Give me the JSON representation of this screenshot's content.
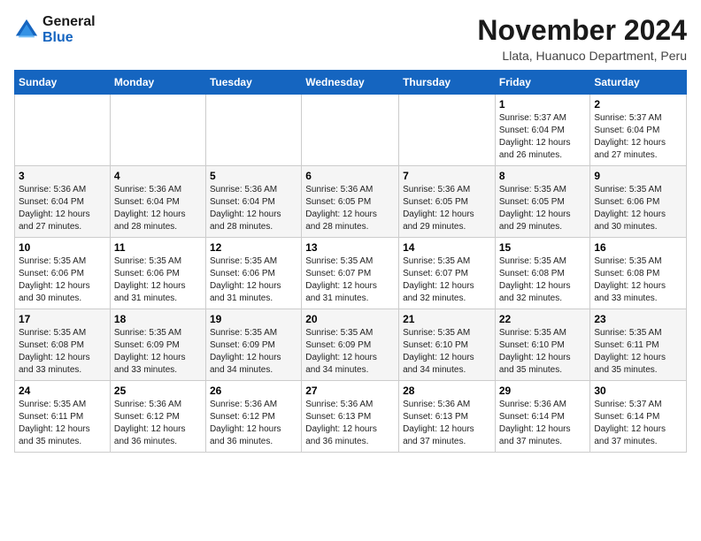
{
  "logo": {
    "line1": "General",
    "line2": "Blue"
  },
  "title": "November 2024",
  "location": "Llata, Huanuco Department, Peru",
  "days_of_week": [
    "Sunday",
    "Monday",
    "Tuesday",
    "Wednesday",
    "Thursday",
    "Friday",
    "Saturday"
  ],
  "weeks": [
    [
      {
        "day": "",
        "info": ""
      },
      {
        "day": "",
        "info": ""
      },
      {
        "day": "",
        "info": ""
      },
      {
        "day": "",
        "info": ""
      },
      {
        "day": "",
        "info": ""
      },
      {
        "day": "1",
        "info": "Sunrise: 5:37 AM\nSunset: 6:04 PM\nDaylight: 12 hours\nand 26 minutes."
      },
      {
        "day": "2",
        "info": "Sunrise: 5:37 AM\nSunset: 6:04 PM\nDaylight: 12 hours\nand 27 minutes."
      }
    ],
    [
      {
        "day": "3",
        "info": "Sunrise: 5:36 AM\nSunset: 6:04 PM\nDaylight: 12 hours\nand 27 minutes."
      },
      {
        "day": "4",
        "info": "Sunrise: 5:36 AM\nSunset: 6:04 PM\nDaylight: 12 hours\nand 28 minutes."
      },
      {
        "day": "5",
        "info": "Sunrise: 5:36 AM\nSunset: 6:04 PM\nDaylight: 12 hours\nand 28 minutes."
      },
      {
        "day": "6",
        "info": "Sunrise: 5:36 AM\nSunset: 6:05 PM\nDaylight: 12 hours\nand 28 minutes."
      },
      {
        "day": "7",
        "info": "Sunrise: 5:36 AM\nSunset: 6:05 PM\nDaylight: 12 hours\nand 29 minutes."
      },
      {
        "day": "8",
        "info": "Sunrise: 5:35 AM\nSunset: 6:05 PM\nDaylight: 12 hours\nand 29 minutes."
      },
      {
        "day": "9",
        "info": "Sunrise: 5:35 AM\nSunset: 6:06 PM\nDaylight: 12 hours\nand 30 minutes."
      }
    ],
    [
      {
        "day": "10",
        "info": "Sunrise: 5:35 AM\nSunset: 6:06 PM\nDaylight: 12 hours\nand 30 minutes."
      },
      {
        "day": "11",
        "info": "Sunrise: 5:35 AM\nSunset: 6:06 PM\nDaylight: 12 hours\nand 31 minutes."
      },
      {
        "day": "12",
        "info": "Sunrise: 5:35 AM\nSunset: 6:06 PM\nDaylight: 12 hours\nand 31 minutes."
      },
      {
        "day": "13",
        "info": "Sunrise: 5:35 AM\nSunset: 6:07 PM\nDaylight: 12 hours\nand 31 minutes."
      },
      {
        "day": "14",
        "info": "Sunrise: 5:35 AM\nSunset: 6:07 PM\nDaylight: 12 hours\nand 32 minutes."
      },
      {
        "day": "15",
        "info": "Sunrise: 5:35 AM\nSunset: 6:08 PM\nDaylight: 12 hours\nand 32 minutes."
      },
      {
        "day": "16",
        "info": "Sunrise: 5:35 AM\nSunset: 6:08 PM\nDaylight: 12 hours\nand 33 minutes."
      }
    ],
    [
      {
        "day": "17",
        "info": "Sunrise: 5:35 AM\nSunset: 6:08 PM\nDaylight: 12 hours\nand 33 minutes."
      },
      {
        "day": "18",
        "info": "Sunrise: 5:35 AM\nSunset: 6:09 PM\nDaylight: 12 hours\nand 33 minutes."
      },
      {
        "day": "19",
        "info": "Sunrise: 5:35 AM\nSunset: 6:09 PM\nDaylight: 12 hours\nand 34 minutes."
      },
      {
        "day": "20",
        "info": "Sunrise: 5:35 AM\nSunset: 6:09 PM\nDaylight: 12 hours\nand 34 minutes."
      },
      {
        "day": "21",
        "info": "Sunrise: 5:35 AM\nSunset: 6:10 PM\nDaylight: 12 hours\nand 34 minutes."
      },
      {
        "day": "22",
        "info": "Sunrise: 5:35 AM\nSunset: 6:10 PM\nDaylight: 12 hours\nand 35 minutes."
      },
      {
        "day": "23",
        "info": "Sunrise: 5:35 AM\nSunset: 6:11 PM\nDaylight: 12 hours\nand 35 minutes."
      }
    ],
    [
      {
        "day": "24",
        "info": "Sunrise: 5:35 AM\nSunset: 6:11 PM\nDaylight: 12 hours\nand 35 minutes."
      },
      {
        "day": "25",
        "info": "Sunrise: 5:36 AM\nSunset: 6:12 PM\nDaylight: 12 hours\nand 36 minutes."
      },
      {
        "day": "26",
        "info": "Sunrise: 5:36 AM\nSunset: 6:12 PM\nDaylight: 12 hours\nand 36 minutes."
      },
      {
        "day": "27",
        "info": "Sunrise: 5:36 AM\nSunset: 6:13 PM\nDaylight: 12 hours\nand 36 minutes."
      },
      {
        "day": "28",
        "info": "Sunrise: 5:36 AM\nSunset: 6:13 PM\nDaylight: 12 hours\nand 37 minutes."
      },
      {
        "day": "29",
        "info": "Sunrise: 5:36 AM\nSunset: 6:14 PM\nDaylight: 12 hours\nand 37 minutes."
      },
      {
        "day": "30",
        "info": "Sunrise: 5:37 AM\nSunset: 6:14 PM\nDaylight: 12 hours\nand 37 minutes."
      }
    ]
  ]
}
